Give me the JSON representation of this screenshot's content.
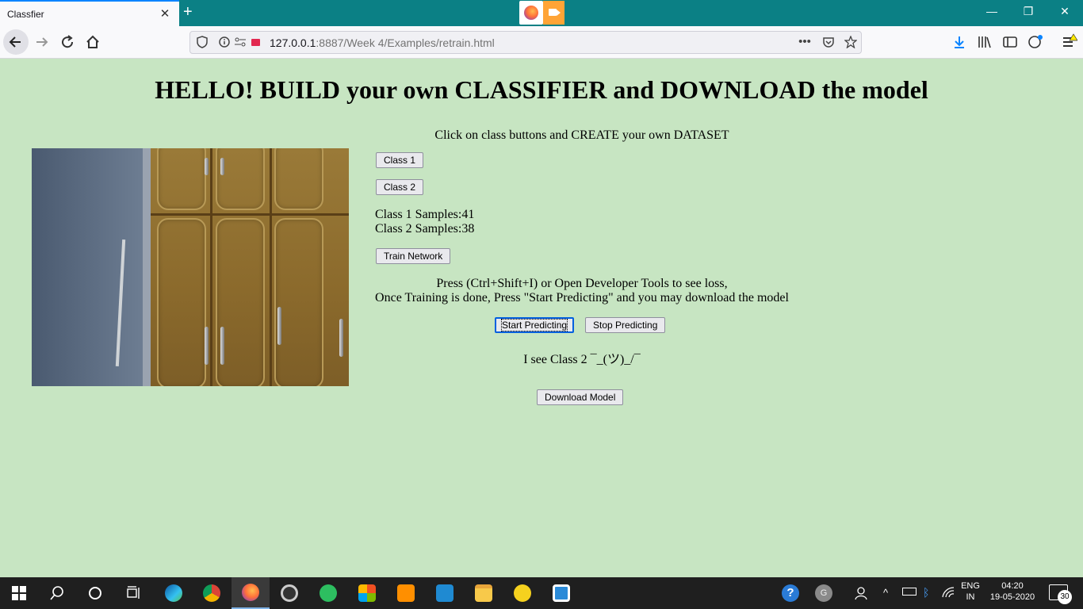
{
  "browser": {
    "tab_title": "Classfier",
    "tab_close": "✕",
    "new_tab": "+",
    "url_host": "127.0.0.1",
    "url_rest": ":8887/Week 4/Examples/retrain.html",
    "url_overflow": "•••",
    "window_minimize": "—",
    "window_restore": "❐",
    "window_close": "✕"
  },
  "page": {
    "heading": "HELLO! BUILD your own CLASSIFIER and DOWNLOAD the model",
    "instruction": "Click on class buttons and CREATE your own DATASET",
    "class1_button": "Class 1",
    "class2_button": "Class 2",
    "class1_samples": "Class 1 Samples:41",
    "class2_samples": "Class 2 Samples:38",
    "train_button": "Train Network",
    "note_line1": "Press (Ctrl+Shift+I) or Open Developer Tools to see loss,",
    "note_line2": "Once Training is done, Press \"Start Predicting\" and you may download the model",
    "start_button": "Start Predicting",
    "stop_button": "Stop Predicting",
    "prediction": "I see Class 2 ¯_(ツ)_/¯",
    "download_button": "Download Model"
  },
  "taskbar": {
    "language_line1": "ENG",
    "language_line2": "IN",
    "time": "04:20",
    "date": "19-05-2020",
    "notification_count": "30",
    "avatar_letter": "G"
  }
}
